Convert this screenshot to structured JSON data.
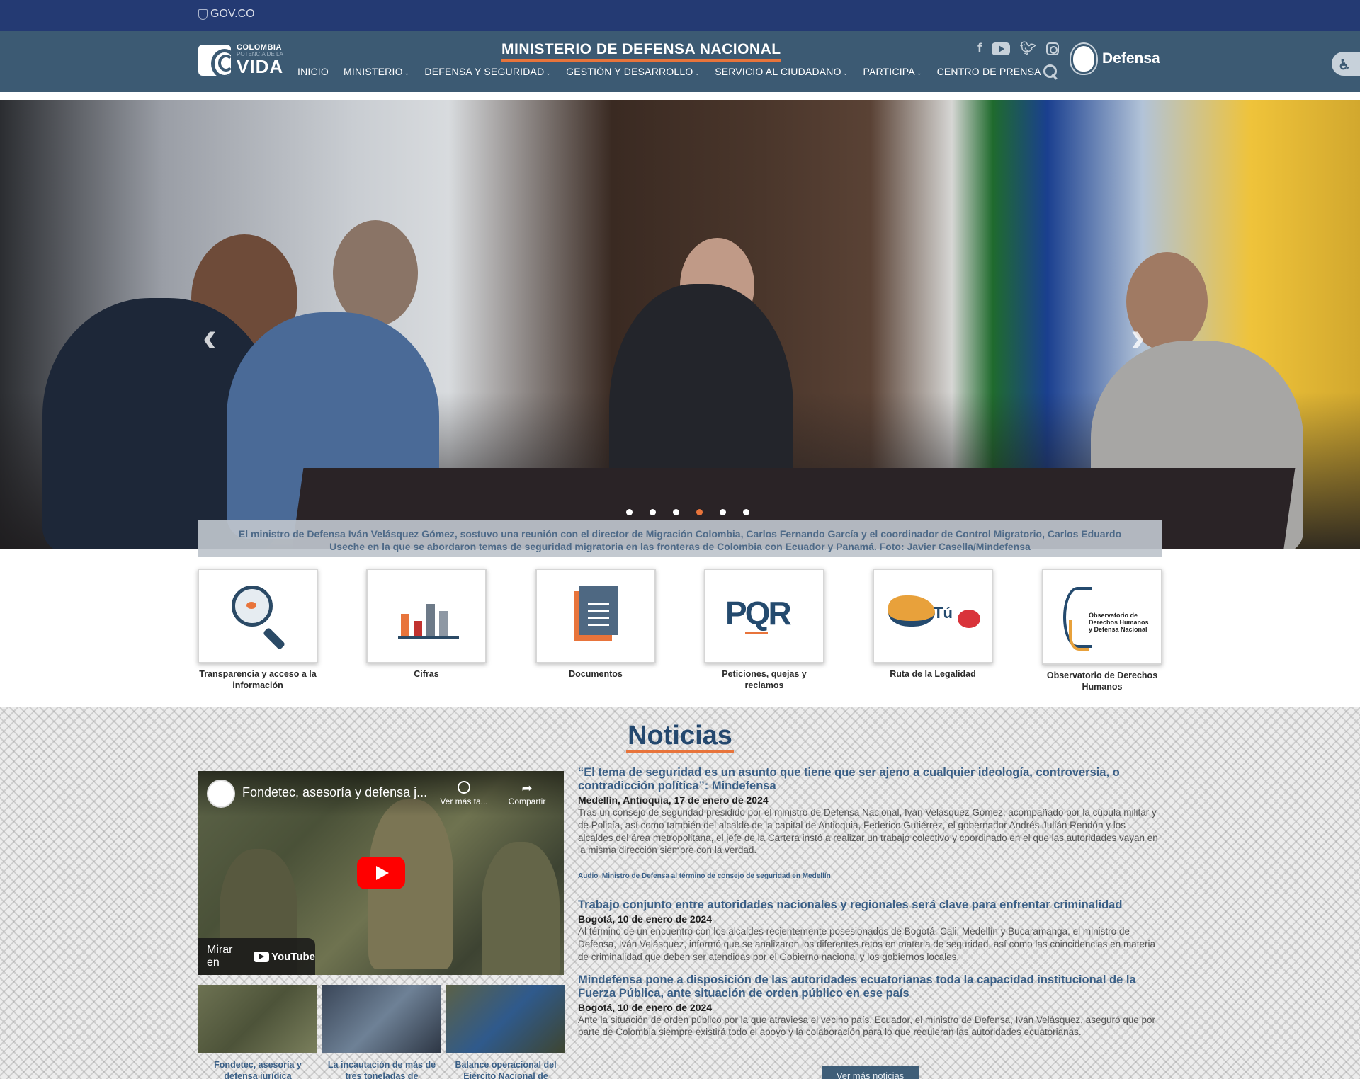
{
  "govbar": {
    "label": "GOV.CO"
  },
  "header": {
    "logo": {
      "line1": "COLOMBIA",
      "line2": "POTENCIA DE LA",
      "line3": "VIDA"
    },
    "title": "MINISTERIO DE DEFENSA NACIONAL",
    "brand": "Defensa",
    "nav": [
      {
        "label": "INICIO",
        "dropdown": false
      },
      {
        "label": "MINISTERIO",
        "dropdown": true
      },
      {
        "label": "DEFENSA Y SEGURIDAD",
        "dropdown": true
      },
      {
        "label": "GESTIÓN Y DESARROLLO",
        "dropdown": true
      },
      {
        "label": "SERVICIO AL CIUDADANO",
        "dropdown": true
      },
      {
        "label": "PARTICIPA",
        "dropdown": true
      },
      {
        "label": "CENTRO DE PRENSA",
        "dropdown": true
      }
    ],
    "social": [
      "facebook-icon",
      "youtube-icon",
      "twitter-icon",
      "instagram-icon"
    ]
  },
  "hero": {
    "caption": "El ministro de Defensa Iván Velásquez Gómez, sostuvo una reunión con el director de Migración Colombia, Carlos Fernando García y el coordinador de Control Migratorio, Carlos Eduardo Useche en la que se abordaron temas de seguridad migratoria en las fronteras de Colombia con Ecuador y Panamá. Foto: Javier Casella/Mindefensa",
    "slide_count": 6,
    "active_slide": 4
  },
  "quick_links": [
    {
      "label": "Transparencia y acceso a la información",
      "icon": "transparency-icon"
    },
    {
      "label": "Cifras",
      "icon": "chart-icon"
    },
    {
      "label": "Documentos",
      "icon": "documents-icon"
    },
    {
      "label": "Peticiones, quejas y reclamos",
      "icon": "pqr-icon"
    },
    {
      "label": "Ruta de la Legalidad",
      "icon": "tu-mas-importas-logo"
    },
    {
      "label": "Observatorio de Derechos Humanos",
      "icon": "observatorio-logo",
      "logo_text": "Observatorio de Derechos Humanos y Defensa Nacional"
    }
  ],
  "news": {
    "title": "Noticias",
    "video": {
      "title": "Fondetec, asesoría y defensa j...",
      "watch_later": "Ver más ta...",
      "share": "Compartir",
      "watch_on": "Mirar en",
      "platform": "YouTube"
    },
    "thumbs": [
      {
        "caption": "Fondetec, asesoría y defensa jurídica"
      },
      {
        "caption": "La incautación de más de tres toneladas de"
      },
      {
        "caption": "Balance operacional del Ejército Nacional de"
      }
    ],
    "articles": [
      {
        "headline": "“El tema de seguridad es un asunto que tiene que ser ajeno a cualquier ideología, controversia, o contradicción política”: Mindefensa",
        "dateline": "Medellín, Antioquia, 17 de enero de 2024",
        "text": "Tras un consejo de seguridad presidido por el ministro de Defensa Nacional, Iván Velásquez Gómez, acompañado por la cúpula militar y de Policía, así como también del alcalde de la capital de Antioquia, Federico Gutiérrez, el gobernador Andrés Julián Rendón y los alcaldes del área metropolitana, el jefe de la Cartera instó a realizar un trabajo colectivo y coordinado en el que las autoridades vayan en la misma dirección siempre con la verdad."
      },
      {
        "headline": "Trabajo conjunto entre autoridades nacionales y regionales será clave para enfrentar criminalidad",
        "dateline": "Bogotá, 10 de enero de 2024",
        "text": "Al término de un encuentro con los alcaldes recientemente posesionados de Bogotá, Cali, Medellín y Bucaramanga, el ministro de Defensa, Iván Velásquez, informó que se analizaron los diferentes retos en materia de seguridad, así como las coincidencias en materia de criminalidad que deben ser atendidas por el Gobierno nacional y los gobiernos locales."
      },
      {
        "headline": "Mindefensa pone a disposición de las autoridades ecuatorianas toda la capacidad institucional de la Fuerza Pública, ante situación de orden público en ese país",
        "dateline": "Bogotá, 10 de enero de 2024",
        "text": "Ante la situación de orden público por la que atraviesa el vecino país, Ecuador, el ministro de Defensa, Iván Velásquez, aseguró que por parte de Colombia siempre existirá todo el apoyo y la colaboración para lo que requieran las autoridades ecuatorianas."
      }
    ],
    "audio_link": "Audio_Ministro de Defensa al término de consejo de seguridad en Medellín",
    "more_button": "Ver más noticias"
  },
  "colors": {
    "govbar": "#243a73",
    "header": "#3c5a73",
    "accent": "#e8743b",
    "headline": "#3a5f86"
  }
}
